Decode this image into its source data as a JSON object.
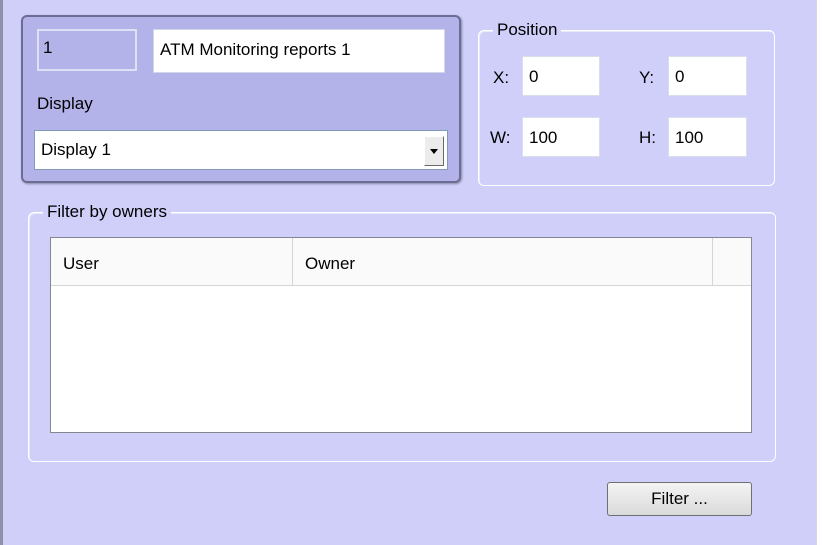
{
  "object": {
    "id": "1",
    "name": "ATM Monitoring reports 1",
    "display_label": "Display",
    "display_value": "Display 1"
  },
  "position": {
    "title": "Position",
    "x_label": "X:",
    "x_value": "0",
    "y_label": "Y:",
    "y_value": "0",
    "w_label": "W:",
    "w_value": "100",
    "h_label": "H:",
    "h_value": "100"
  },
  "filter_by_owners": {
    "title": "Filter by owners",
    "columns": [
      "User",
      "Owner"
    ],
    "rows": []
  },
  "filter_button_label": "Filter ..."
}
